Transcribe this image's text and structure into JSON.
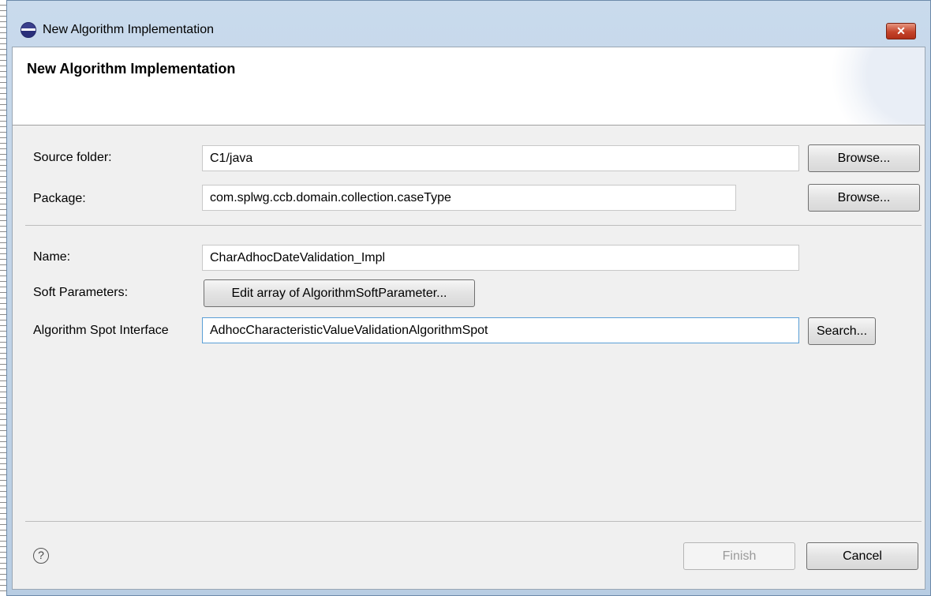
{
  "window": {
    "title": "New Algorithm Implementation",
    "close_label": "✕"
  },
  "banner": {
    "title": "New Algorithm Implementation"
  },
  "form": {
    "source_folder_label": "Source folder:",
    "source_folder_value": "C1/java",
    "package_label": "Package:",
    "package_value": "com.splwg.ccb.domain.collection.caseType",
    "browse_label": "Browse...",
    "name_label": "Name:",
    "name_value": "CharAdhocDateValidation_Impl",
    "soft_params_label": "Soft Parameters:",
    "soft_params_button": "Edit array of AlgorithmSoftParameter...",
    "spot_label": "Algorithm Spot Interface",
    "spot_value": "AdhocCharacteristicValueValidationAlgorithmSpot",
    "search_label": "Search..."
  },
  "footer": {
    "help_icon": "?",
    "finish_label": "Finish",
    "cancel_label": "Cancel"
  },
  "icons": {
    "app": "eclipse-icon",
    "close": "close-icon",
    "help": "help-icon"
  }
}
